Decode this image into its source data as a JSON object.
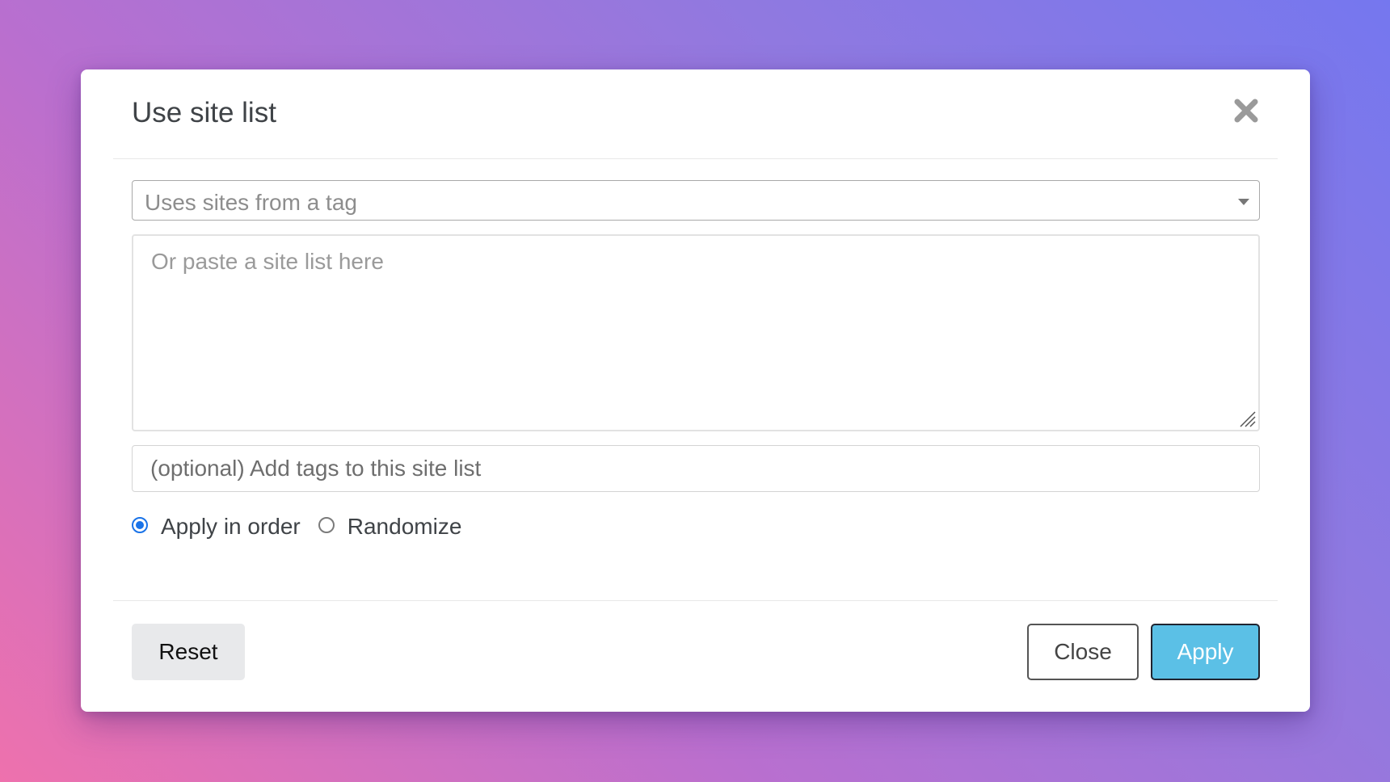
{
  "dialog": {
    "title": "Use site list",
    "close_icon": "close-x-icon"
  },
  "tag_select": {
    "placeholder": "Uses sites from a tag",
    "icon": "chevron-down-icon"
  },
  "site_list": {
    "value": "",
    "placeholder": "Or paste a site list here"
  },
  "tags_field": {
    "value": "",
    "placeholder": "(optional) Add tags to this site list"
  },
  "order_options": [
    {
      "label": "Apply in order",
      "selected": true
    },
    {
      "label": "Randomize",
      "selected": false
    }
  ],
  "footer": {
    "reset_label": "Reset",
    "close_label": "Close",
    "apply_label": "Apply"
  },
  "colors": {
    "accent": "#1a73e8",
    "apply_button": "#5bc0e6",
    "reset_button": "#e8e9eb"
  }
}
